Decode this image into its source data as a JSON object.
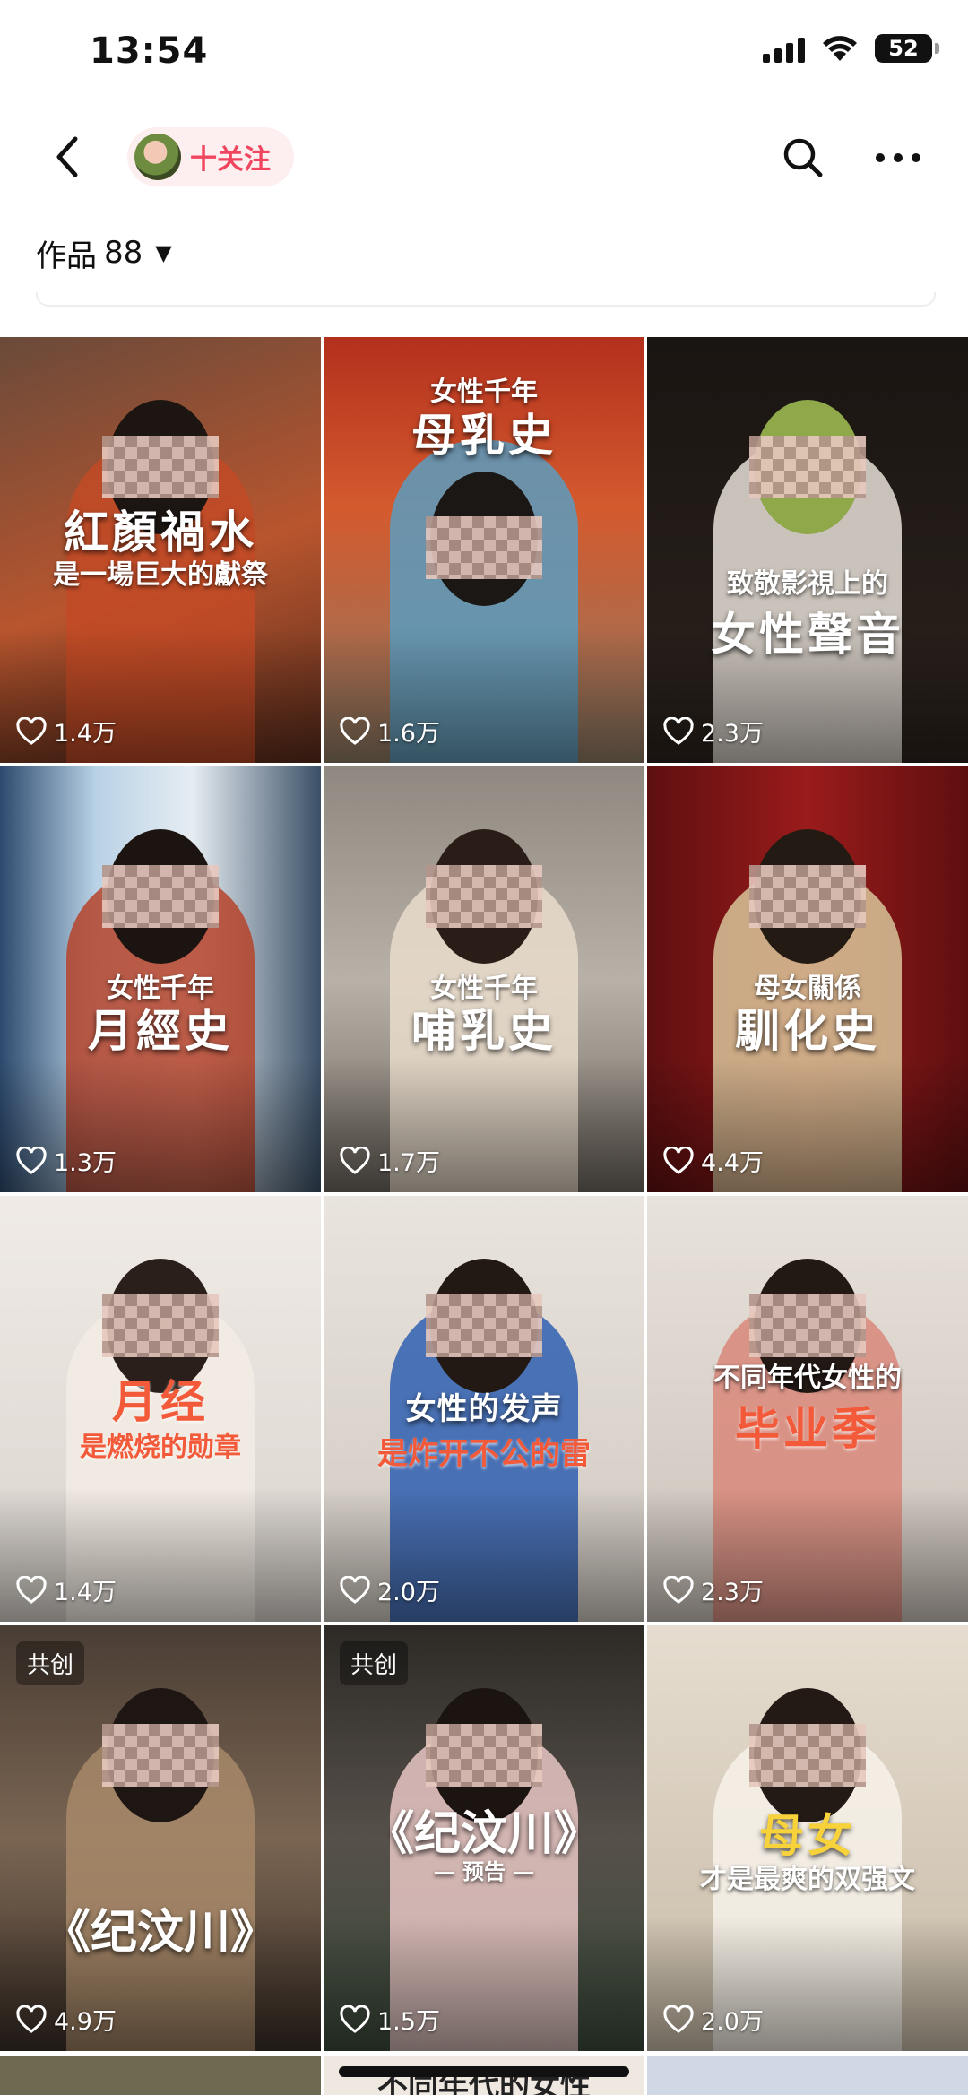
{
  "status_bar": {
    "time": "13:54",
    "battery": "52"
  },
  "header": {
    "follow_label": "十关注"
  },
  "works": {
    "label": "作品",
    "count": "88"
  },
  "colors": {
    "accent": "#f0455f",
    "pill_bg": "#fdeef0"
  },
  "icons": {
    "back": "chevron-left-icon",
    "search": "search-icon",
    "more": "more-dots-icon",
    "like": "heart-icon"
  },
  "tiles": [
    {
      "line1": "",
      "line2": "紅顏禍水",
      "line3": "是一場巨大的獻祭",
      "likes": "1.4万",
      "badge": ""
    },
    {
      "line1": "女性千年",
      "line2": "母乳史",
      "line3": "",
      "likes": "1.6万",
      "badge": ""
    },
    {
      "line1": "致敬影視上的",
      "line2": "女性聲音",
      "line3": "",
      "likes": "2.3万",
      "badge": ""
    },
    {
      "line1": "女性千年",
      "line2": "月經史",
      "line3": "",
      "likes": "1.3万",
      "badge": ""
    },
    {
      "line1": "女性千年",
      "line2": "哺乳史",
      "line3": "",
      "likes": "1.7万",
      "badge": ""
    },
    {
      "line1": "母女關係",
      "line2": "馴化史",
      "line3": "",
      "likes": "4.4万",
      "badge": ""
    },
    {
      "line1": "",
      "line2": "月经",
      "line3": "是燃烧的勋章",
      "likes": "1.4万",
      "badge": ""
    },
    {
      "line1": "",
      "line2": "女性的发声",
      "line3": "是炸开不公的雷",
      "likes": "2.0万",
      "badge": ""
    },
    {
      "line1": "不同年代女性的",
      "line2": "毕业季",
      "line3": "",
      "likes": "2.3万",
      "badge": ""
    },
    {
      "line1": "",
      "line2": "《纪汶川》",
      "line3": "",
      "likes": "4.9万",
      "badge": "共创"
    },
    {
      "line1": "",
      "line2": "《纪汶川》",
      "line3": "— 预告 —",
      "likes": "1.5万",
      "badge": "共创"
    },
    {
      "line1": "",
      "line2": "母女",
      "line3": "才是最爽的双强文",
      "likes": "2.0万",
      "badge": ""
    }
  ],
  "partial_row_text": "不同年代的女性"
}
